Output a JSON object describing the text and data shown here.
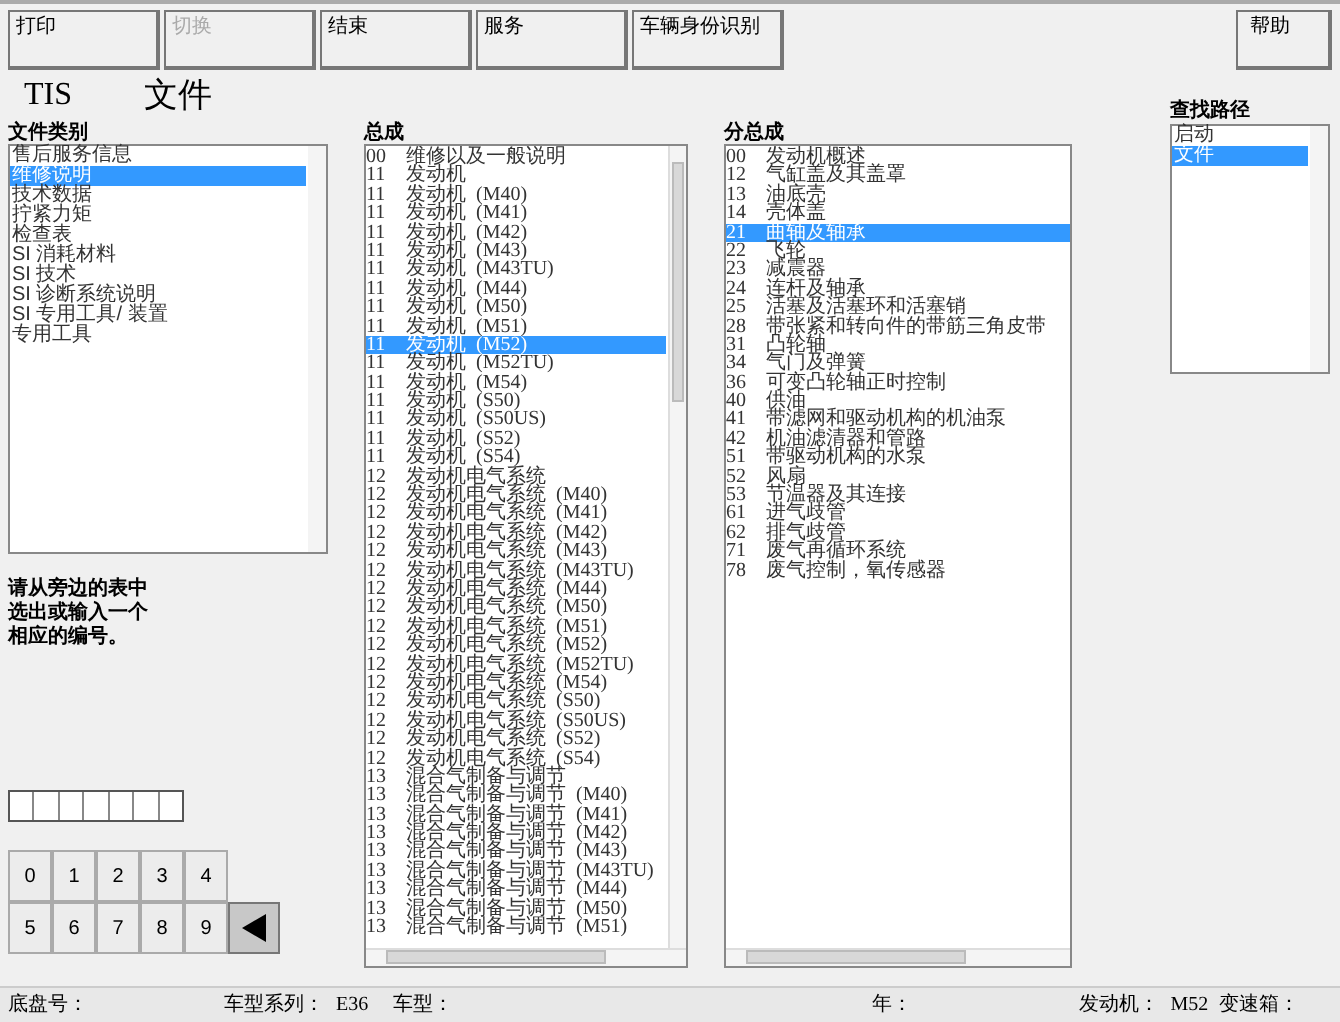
{
  "toolbar": [
    {
      "label": "打印",
      "disabled": false
    },
    {
      "label": "切换",
      "disabled": true
    },
    {
      "label": "结束",
      "disabled": false
    },
    {
      "label": "服务",
      "disabled": false
    },
    {
      "label": "车辆身份识别",
      "disabled": false
    }
  ],
  "help_button": "帮助",
  "app_name": "TIS",
  "page_title": "文件",
  "category": {
    "title": "文件类别",
    "items": [
      {
        "text": "售后服务信息",
        "selected": false
      },
      {
        "text": "维修说明",
        "selected": true
      },
      {
        "text": "技术数据",
        "selected": false
      },
      {
        "text": "拧紧力矩",
        "selected": false
      },
      {
        "text": "检查表",
        "selected": false
      },
      {
        "text": "SI 消耗材料",
        "selected": false
      },
      {
        "text": "SI 技术",
        "selected": false
      },
      {
        "text": "SI 诊断系统说明",
        "selected": false
      },
      {
        "text": "SI 专用工具/ 装置",
        "selected": false
      },
      {
        "text": "专用工具",
        "selected": false
      }
    ]
  },
  "hint": "请从旁边的表中选出或输入一个相应的编号。",
  "keypad": {
    "digits": [
      "0",
      "1",
      "2",
      "3",
      "4",
      "5",
      "6",
      "7",
      "8",
      "9"
    ]
  },
  "assembly": {
    "title": "总成",
    "items": [
      {
        "code": "00",
        "name": "维修以及一般说明",
        "selected": false
      },
      {
        "code": "11",
        "name": "发动机",
        "selected": false
      },
      {
        "code": "11",
        "name": "发动机  (M40)",
        "selected": false
      },
      {
        "code": "11",
        "name": "发动机  (M41)",
        "selected": false
      },
      {
        "code": "11",
        "name": "发动机  (M42)",
        "selected": false
      },
      {
        "code": "11",
        "name": "发动机  (M43)",
        "selected": false
      },
      {
        "code": "11",
        "name": "发动机  (M43TU)",
        "selected": false
      },
      {
        "code": "11",
        "name": "发动机  (M44)",
        "selected": false
      },
      {
        "code": "11",
        "name": "发动机  (M50)",
        "selected": false
      },
      {
        "code": "11",
        "name": "发动机  (M51)",
        "selected": false
      },
      {
        "code": "11",
        "name": "发动机  (M52)",
        "selected": true
      },
      {
        "code": "11",
        "name": "发动机  (M52TU)",
        "selected": false
      },
      {
        "code": "11",
        "name": "发动机  (M54)",
        "selected": false
      },
      {
        "code": "11",
        "name": "发动机  (S50)",
        "selected": false
      },
      {
        "code": "11",
        "name": "发动机  (S50US)",
        "selected": false
      },
      {
        "code": "11",
        "name": "发动机  (S52)",
        "selected": false
      },
      {
        "code": "11",
        "name": "发动机  (S54)",
        "selected": false
      },
      {
        "code": "12",
        "name": "发动机电气系统",
        "selected": false
      },
      {
        "code": "12",
        "name": "发动机电气系统  (M40)",
        "selected": false
      },
      {
        "code": "12",
        "name": "发动机电气系统  (M41)",
        "selected": false
      },
      {
        "code": "12",
        "name": "发动机电气系统  (M42)",
        "selected": false
      },
      {
        "code": "12",
        "name": "发动机电气系统  (M43)",
        "selected": false
      },
      {
        "code": "12",
        "name": "发动机电气系统  (M43TU)",
        "selected": false
      },
      {
        "code": "12",
        "name": "发动机电气系统  (M44)",
        "selected": false
      },
      {
        "code": "12",
        "name": "发动机电气系统  (M50)",
        "selected": false
      },
      {
        "code": "12",
        "name": "发动机电气系统  (M51)",
        "selected": false
      },
      {
        "code": "12",
        "name": "发动机电气系统  (M52)",
        "selected": false
      },
      {
        "code": "12",
        "name": "发动机电气系统  (M52TU)",
        "selected": false
      },
      {
        "code": "12",
        "name": "发动机电气系统  (M54)",
        "selected": false
      },
      {
        "code": "12",
        "name": "发动机电气系统  (S50)",
        "selected": false
      },
      {
        "code": "12",
        "name": "发动机电气系统  (S50US)",
        "selected": false
      },
      {
        "code": "12",
        "name": "发动机电气系统  (S52)",
        "selected": false
      },
      {
        "code": "12",
        "name": "发动机电气系统  (S54)",
        "selected": false
      },
      {
        "code": "13",
        "name": "混合气制备与调节",
        "selected": false
      },
      {
        "code": "13",
        "name": "混合气制备与调节  (M40)",
        "selected": false
      },
      {
        "code": "13",
        "name": "混合气制备与调节  (M41)",
        "selected": false
      },
      {
        "code": "13",
        "name": "混合气制备与调节  (M42)",
        "selected": false
      },
      {
        "code": "13",
        "name": "混合气制备与调节  (M43)",
        "selected": false
      },
      {
        "code": "13",
        "name": "混合气制备与调节  (M43TU)",
        "selected": false
      },
      {
        "code": "13",
        "name": "混合气制备与调节  (M44)",
        "selected": false
      },
      {
        "code": "13",
        "name": "混合气制备与调节  (M50)",
        "selected": false
      },
      {
        "code": "13",
        "name": "混合气制备与调节  (M51)",
        "selected": false
      }
    ]
  },
  "subassembly": {
    "title": "分总成",
    "items": [
      {
        "code": "00",
        "name": "发动机概述",
        "selected": false
      },
      {
        "code": "12",
        "name": "气缸盖及其盖罩",
        "selected": false
      },
      {
        "code": "13",
        "name": "油底壳",
        "selected": false
      },
      {
        "code": "14",
        "name": "壳体盖",
        "selected": false
      },
      {
        "code": "21",
        "name": "曲轴及轴承",
        "selected": true
      },
      {
        "code": "22",
        "name": "飞轮",
        "selected": false
      },
      {
        "code": "23",
        "name": "减震器",
        "selected": false
      },
      {
        "code": "24",
        "name": "连杆及轴承",
        "selected": false
      },
      {
        "code": "25",
        "name": "活塞及活塞环和活塞销",
        "selected": false
      },
      {
        "code": "28",
        "name": "带张紧和转向件的带筋三角皮带",
        "selected": false
      },
      {
        "code": "31",
        "name": "凸轮轴",
        "selected": false
      },
      {
        "code": "34",
        "name": "气门及弹簧",
        "selected": false
      },
      {
        "code": "36",
        "name": "可变凸轮轴正时控制",
        "selected": false
      },
      {
        "code": "40",
        "name": "供油",
        "selected": false
      },
      {
        "code": "41",
        "name": "带滤网和驱动机构的机油泵",
        "selected": false
      },
      {
        "code": "42",
        "name": "机油滤清器和管路",
        "selected": false
      },
      {
        "code": "51",
        "name": "带驱动机构的水泵",
        "selected": false
      },
      {
        "code": "52",
        "name": "风扇",
        "selected": false
      },
      {
        "code": "53",
        "name": "节温器及其连接",
        "selected": false
      },
      {
        "code": "61",
        "name": "进气歧管",
        "selected": false
      },
      {
        "code": "62",
        "name": "排气歧管",
        "selected": false
      },
      {
        "code": "71",
        "name": "废气再循环系统",
        "selected": false
      },
      {
        "code": "78",
        "name": "废气控制，氧传感器",
        "selected": false
      }
    ]
  },
  "search_path": {
    "title": "查找路径",
    "items": [
      {
        "text": "启动",
        "selected": false
      },
      {
        "text": "文件",
        "selected": true
      }
    ]
  },
  "status_bar": [
    {
      "label": "底盘号："
    },
    {
      "label": "车型系列：",
      "value": "E36"
    },
    {
      "label": "车型："
    },
    {
      "label": "年："
    },
    {
      "label": "发动机：",
      "value": "M52"
    },
    {
      "label": "变速箱："
    }
  ]
}
